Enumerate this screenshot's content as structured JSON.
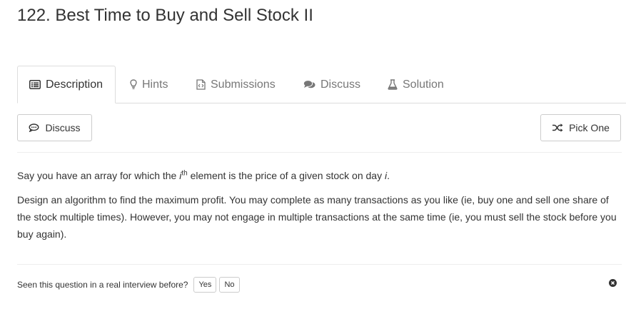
{
  "problem": {
    "title": "122. Best Time to Buy and Sell Stock II"
  },
  "tabs": [
    {
      "label": "Description",
      "icon": "list-icon",
      "active": true
    },
    {
      "label": "Hints",
      "icon": "lightbulb-icon"
    },
    {
      "label": "Submissions",
      "icon": "code-file-icon"
    },
    {
      "label": "Discuss",
      "icon": "comments-icon"
    },
    {
      "label": "Solution",
      "icon": "flask-icon"
    }
  ],
  "actions": {
    "discuss_label": "Discuss",
    "pick_one_label": "Pick One"
  },
  "description": {
    "p1_before": "Say you have an array for which the ",
    "p1_var": "i",
    "p1_sup": "th",
    "p1_after": " element is the price of a given stock on day ",
    "p1_day_var": "i",
    "p1_end": ".",
    "p2": "Design an algorithm to find the maximum profit. You may complete as many transactions as you like (ie, buy one and sell one share of the stock multiple times). However, you may not engage in multiple transactions at the same time (ie, you must sell the stock before you buy again)."
  },
  "feedback": {
    "question": "Seen this question in a real interview before?",
    "yes_label": "Yes",
    "no_label": "No"
  }
}
